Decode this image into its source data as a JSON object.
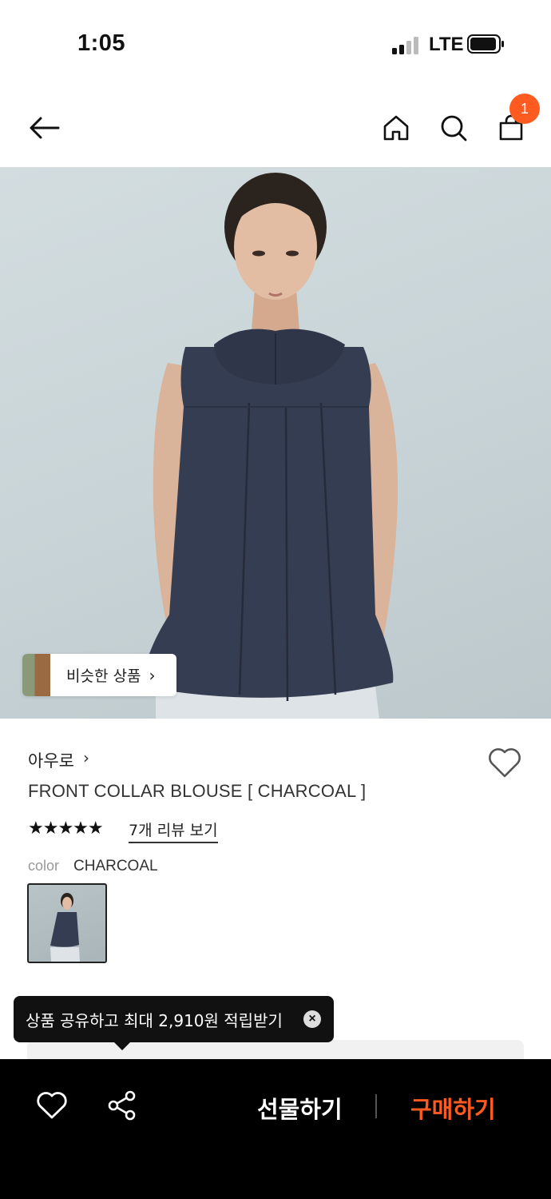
{
  "status_bar": {
    "time": "1:05",
    "network": "LTE"
  },
  "header": {
    "cart_count": "1"
  },
  "hero": {
    "similar_label": "비슷한 상품",
    "similar_chevron": "›"
  },
  "product": {
    "brand": "아우로",
    "brand_chevron": "›",
    "title": "FRONT COLLAR BLOUSE [ CHARCOAL ]",
    "stars": "★★★★★",
    "rating_stars": 5,
    "reviews_link": "7개 리뷰 보기",
    "color_label": "color",
    "color_value": "CHARCOAL"
  },
  "tooltip": {
    "text": "상품 공유하고 최대 2,910원 적립받기",
    "close_symbol": "×"
  },
  "bottom_bar": {
    "gift_label": "선물하기",
    "buy_label": "구매하기"
  },
  "colors": {
    "accent": "#ff5a1f",
    "bottom_bar_bg": "#000000",
    "tooltip_bg": "#111111"
  },
  "icons": [
    "back-arrow-icon",
    "home-icon",
    "search-icon",
    "cart-icon",
    "heart-icon",
    "share-icon",
    "close-icon"
  ]
}
